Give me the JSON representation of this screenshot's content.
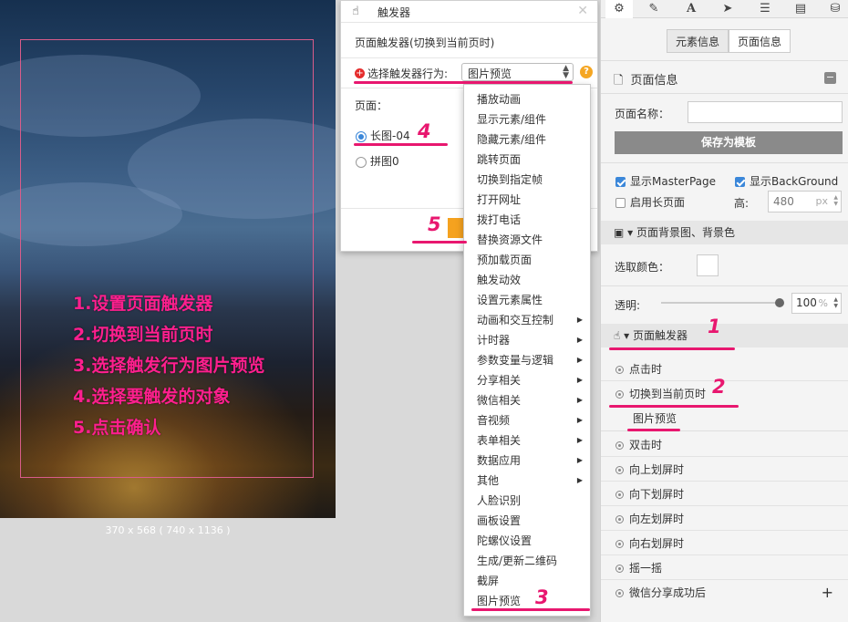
{
  "canvas": {
    "steps": [
      "1.设置页面触发器",
      "2.切换到当前页时",
      "3.选择触发行为图片预览",
      "4.选择要触发的对象",
      "5.点击确认"
    ],
    "size_label": "370 x 568 ( 740 x 1136 )"
  },
  "dialog": {
    "title": "触发器",
    "subtitle": "页面触发器(切换到当前页时)",
    "action_label": "选择触发器行为:",
    "action_value": "图片预览",
    "page_label": "页面：",
    "pages": [
      {
        "label": "长图-04",
        "selected": true
      },
      {
        "label": "拼图0",
        "selected": false
      }
    ]
  },
  "dropdown": {
    "items": [
      {
        "label": "播放动画",
        "submenu": false
      },
      {
        "label": "显示元素/组件",
        "submenu": false
      },
      {
        "label": "隐藏元素/组件",
        "submenu": false
      },
      {
        "label": "跳转页面",
        "submenu": false
      },
      {
        "label": "切换到指定帧",
        "submenu": false
      },
      {
        "label": "打开网址",
        "submenu": false
      },
      {
        "label": "拨打电话",
        "submenu": false
      },
      {
        "label": "替换资源文件",
        "submenu": false
      },
      {
        "label": "预加载页面",
        "submenu": false
      },
      {
        "label": "触发动效",
        "submenu": false
      },
      {
        "label": "设置元素属性",
        "submenu": false
      },
      {
        "label": "动画和交互控制",
        "submenu": true
      },
      {
        "label": "计时器",
        "submenu": true
      },
      {
        "label": "参数变量与逻辑",
        "submenu": true
      },
      {
        "label": "分享相关",
        "submenu": true
      },
      {
        "label": "微信相关",
        "submenu": true
      },
      {
        "label": "音视频",
        "submenu": true
      },
      {
        "label": "表单相关",
        "submenu": true
      },
      {
        "label": "数据应用",
        "submenu": true
      },
      {
        "label": "其他",
        "submenu": true
      },
      {
        "label": "人脸识别",
        "submenu": false
      },
      {
        "label": "画板设置",
        "submenu": false
      },
      {
        "label": "陀螺仪设置",
        "submenu": false
      },
      {
        "label": "生成/更新二维码",
        "submenu": false
      },
      {
        "label": "截屏",
        "submenu": false
      },
      {
        "label": "图片预览",
        "submenu": false
      }
    ]
  },
  "annotations": {
    "n1": "1",
    "n2": "2",
    "n3": "3",
    "n4": "4",
    "n5": "5"
  },
  "panel": {
    "toolbar": [
      "gear-icon",
      "pencil-icon",
      "text-icon",
      "send-icon",
      "list-icon",
      "document-icon",
      "database-icon"
    ],
    "tabs": [
      "元素信息",
      "页面信息"
    ],
    "active_tab": "页面信息",
    "title": "页面信息",
    "page_name_label": "页面名称：",
    "page_name_value": "",
    "save_template": "保存为模板",
    "show_masterpage": "显示MasterPage",
    "show_background": "显示BackGround",
    "long_page": "启用长页面",
    "height_label": "高:",
    "height_value": "480",
    "height_unit": "px",
    "bg_section": "页面背景图、背景色",
    "pick_color": "选取颜色：",
    "opacity_label": "透明:",
    "opacity_value": "100",
    "opacity_unit": "%",
    "trigger_section": "页面触发器",
    "events": [
      "点击时",
      "切换到当前页时",
      "双击时",
      "向上划屏时",
      "向下划屏时",
      "向左划屏时",
      "向右划屏时",
      "摇一摇",
      "微信分享成功后"
    ],
    "sub_action": "图片预览",
    "colors": {
      "accent": "#3b87d9",
      "annotation": "#e8176f",
      "save_button": "#8a8a8a",
      "confirm": "#f5a21f"
    }
  }
}
